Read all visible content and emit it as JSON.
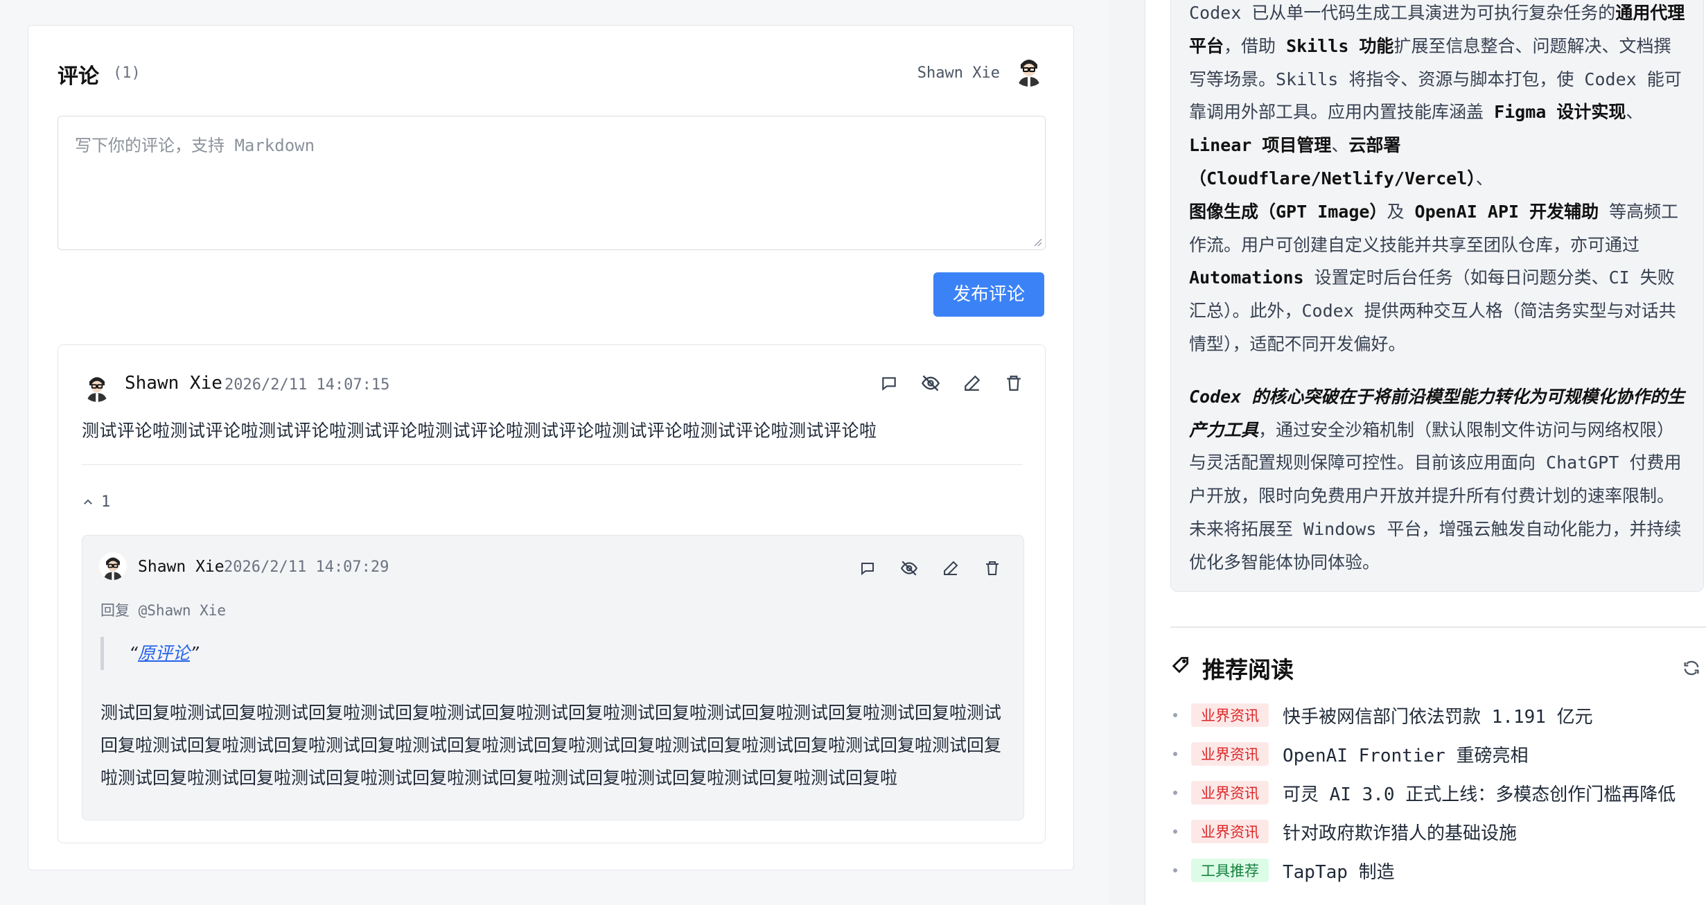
{
  "comments": {
    "header": {
      "title": "评论",
      "count": "(1)",
      "current_user": "Shawn Xie"
    },
    "editor": {
      "placeholder": "写下你的评论，支持 Markdown"
    },
    "publish_label": "发布评论",
    "comment": {
      "author": "Shawn Xie",
      "time": "2026/2/11 14:07:15",
      "body": "测试评论啦测试评论啦测试评论啦测试评论啦测试评论啦测试评论啦测试评论啦测试评论啦测试评论啦",
      "reply_count": "1",
      "actions": [
        "reply-icon",
        "hide-icon",
        "edit-icon",
        "delete-icon"
      ]
    },
    "reply": {
      "author": "Shawn Xie",
      "time": "2026/2/11 14:07:29",
      "reply_to": "回复 @Shawn Xie",
      "quote_open": "“",
      "quote_link": "原评论",
      "quote_close": "”",
      "body": "测试回复啦测试回复啦测试回复啦测试回复啦测试回复啦测试回复啦测试回复啦测试回复啦测试回复啦测试回复啦测试回复啦测试回复啦测试回复啦测试回复啦测试回复啦测试回复啦测试回复啦测试回复啦测试回复啦测试回复啦测试回复啦测试回复啦测试回复啦测试回复啦测试回复啦测试回复啦测试回复啦测试回复啦测试回复啦测试回复啦"
    }
  },
  "sidebar": {
    "summary": {
      "p1_seg1": "Codex 已从单一代码生成工具演进为可执行复杂任务的",
      "p1_b1": "通用代理平台",
      "p1_seg2": "，借助 ",
      "p1_b2": "Skills 功能",
      "p1_seg3": "扩展至信息整合、问题解决、文档撰写等场景。Skills 将指令、资源与脚本打包，使 Codex 能可靠调用外部工具。应用内置技能库涵盖 ",
      "p1_b3": "Figma 设计实现",
      "p1_seg4": "、",
      "p1_b4": "Linear 项目管理",
      "p1_seg5": "、",
      "p1_b5": "云部署（Cloudflare/Netlify/Vercel）",
      "p1_seg6": "、",
      "p1_b6": "图像生成（GPT Image）",
      "p1_seg7": "及 ",
      "p1_b7": "OpenAI API 开发辅助",
      "p1_seg8": " 等高频工作流。用户可创建自定义技能并共享至团队仓库，亦可通过 ",
      "p1_b8": "Automations",
      "p1_seg9": " 设置定时后台任务（如每日问题分类、CI 失败汇总）。此外，Codex 提供两种交互人格（简洁务实型与对话共情型），适配不同开发偏好。",
      "p2_em": "Codex 的核心突破在于将前沿模型能力转化为可规模化协作的生产力工具",
      "p2_rest": "，通过安全沙箱机制（默认限制文件访问与网络权限）与灵活配置规则保障可控性。目前该应用面向 ChatGPT 付费用户开放，限时向免费用户开放并提升所有付费计划的速率限制。未来将拓展至 Windows 平台，增强云触发自动化能力，并持续优化多智能体协同体验。"
    },
    "recommend": {
      "title": "推荐阅读",
      "items": [
        {
          "tag": "业界资讯",
          "tag_type": "news",
          "title": "快手被网信部门依法罚款 1.191 亿元"
        },
        {
          "tag": "业界资讯",
          "tag_type": "news",
          "title": "OpenAI Frontier 重磅亮相"
        },
        {
          "tag": "业界资讯",
          "tag_type": "news",
          "title": "可灵 AI 3.0 正式上线：多模态创作门槛再降低"
        },
        {
          "tag": "业界资讯",
          "tag_type": "news",
          "title": "针对政府欺诈猎人的基础设施"
        },
        {
          "tag": "工具推荐",
          "tag_type": "tool",
          "title": "TapTap 制造"
        }
      ]
    }
  },
  "colors": {
    "accent": "#3b82f6",
    "news_badge": "#dc2626",
    "tool_badge": "#15803d"
  }
}
